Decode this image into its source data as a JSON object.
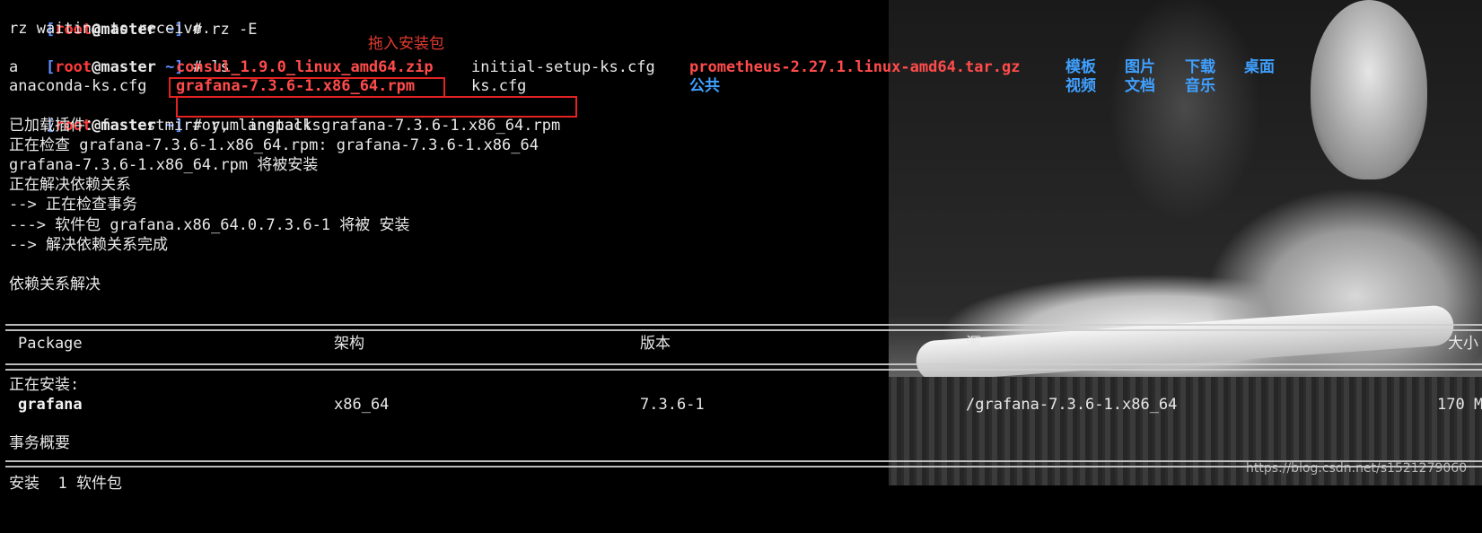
{
  "prompt": {
    "open": "[",
    "user": "root",
    "at": "@",
    "host": "master",
    "path": " ~]",
    "symbol": " # "
  },
  "commands": {
    "rz": "rz -E",
    "ls": "ls",
    "yum": "yum install grafana-7.3.6-1.x86_64.rpm"
  },
  "rz_output": "rz waiting to receive.",
  "annotation": "拖入安装包",
  "ls_output": {
    "row1": {
      "a": "a",
      "consul": "consul_1.9.0_linux_amd64.zip",
      "initial": "initial-setup-ks.cfg",
      "prometheus": "prometheus-2.27.1.linux-amd64.tar.gz",
      "dirs": [
        "模板",
        "图片",
        "下载",
        "桌面"
      ]
    },
    "row2": {
      "anaconda": "anaconda-ks.cfg",
      "grafana": "grafana-7.3.6-1.x86_64.rpm",
      "ks": "ks.cfg",
      "gonggong": "公共",
      "dirs": [
        "视频",
        "文档",
        "音乐"
      ]
    }
  },
  "yum_output": [
    "已加载插件：fastestmirror, langpacks",
    "正在检查 grafana-7.3.6-1.x86_64.rpm: grafana-7.3.6-1.x86_64",
    "grafana-7.3.6-1.x86_64.rpm 将被安装",
    "正在解决依赖关系",
    "--> 正在检查事务",
    "---> 软件包 grafana.x86_64.0.7.3.6-1 将被 安装",
    "--> 解决依赖关系完成",
    "",
    "依赖关系解决"
  ],
  "table": {
    "headers": [
      "Package",
      "架构",
      "版本",
      "源",
      "大小"
    ],
    "section_label": "正在安装:",
    "row": [
      "grafana",
      "x86_64",
      "7.3.6-1",
      "/grafana-7.3.6-1.x86_64",
      "170 M"
    ]
  },
  "summary_title": "事务概要",
  "summary_partial": "安装  1 软件包",
  "watermark": "https://blog.csdn.net/s1521279060",
  "colors": {
    "prompt_bracket": "#5f8fff",
    "prompt_user": "#ff3b3b",
    "archive": "#ff4b4b",
    "directory": "#3fa0ff",
    "highlight_box": "#e32222"
  }
}
